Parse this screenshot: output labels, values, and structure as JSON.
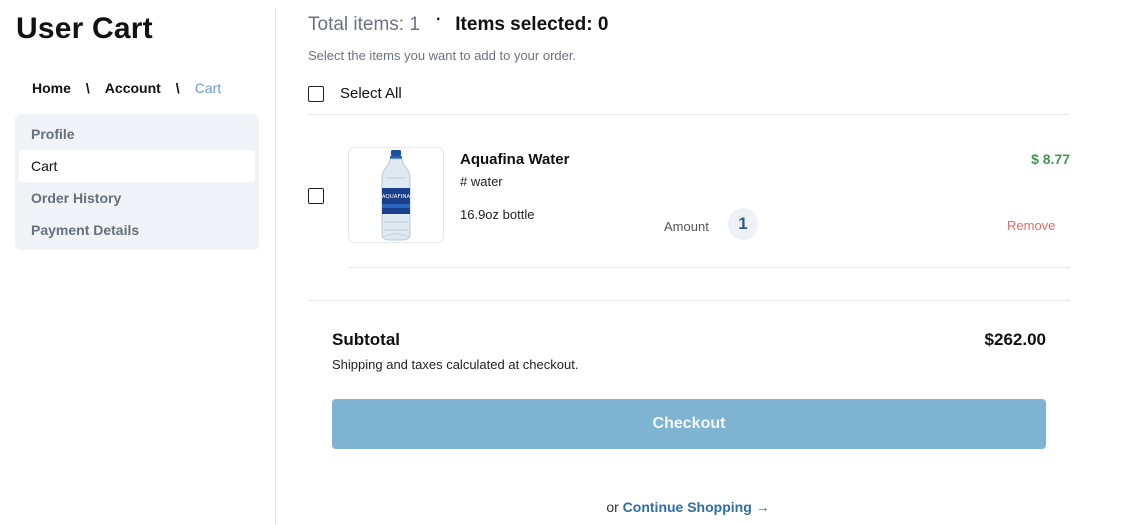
{
  "page": {
    "title": "User Cart"
  },
  "breadcrumb": {
    "items": [
      "Home",
      "Account",
      "Cart"
    ],
    "separator": "\\"
  },
  "sidebar": {
    "items": [
      {
        "label": "Profile",
        "active": false
      },
      {
        "label": "Cart",
        "active": true
      },
      {
        "label": "Order History",
        "active": false
      },
      {
        "label": "Payment Details",
        "active": false
      }
    ]
  },
  "cart": {
    "total_items_text": "Total items: 1",
    "separator_dot": "·",
    "items_selected_text": "Items selected: 0",
    "hint": "Select the items you want to add to your order.",
    "select_all_label": "Select All",
    "items": [
      {
        "name": "Aquafina Water",
        "tag": "# water",
        "size": "16.9oz bottle",
        "price": "$ 8.77",
        "amount_label": "Amount",
        "amount": "1",
        "remove_label": "Remove",
        "checked": false,
        "image_icon": "water-bottle-icon",
        "bottle_label": "AQUAFINA"
      }
    ]
  },
  "summary": {
    "subtotal_label": "Subtotal",
    "subtotal_value": "$262.00",
    "shipping_note": "Shipping and taxes calculated at checkout.",
    "checkout_label": "Checkout",
    "continue_prefix": "or",
    "continue_label": "Continue Shopping →"
  },
  "colors": {
    "accent": "#7fb3d2",
    "price_green": "#3d9a4f",
    "remove_red": "#e06b6b",
    "link_blue": "#2f6ea3",
    "breadcrumb_active": "#6a9fd0"
  }
}
